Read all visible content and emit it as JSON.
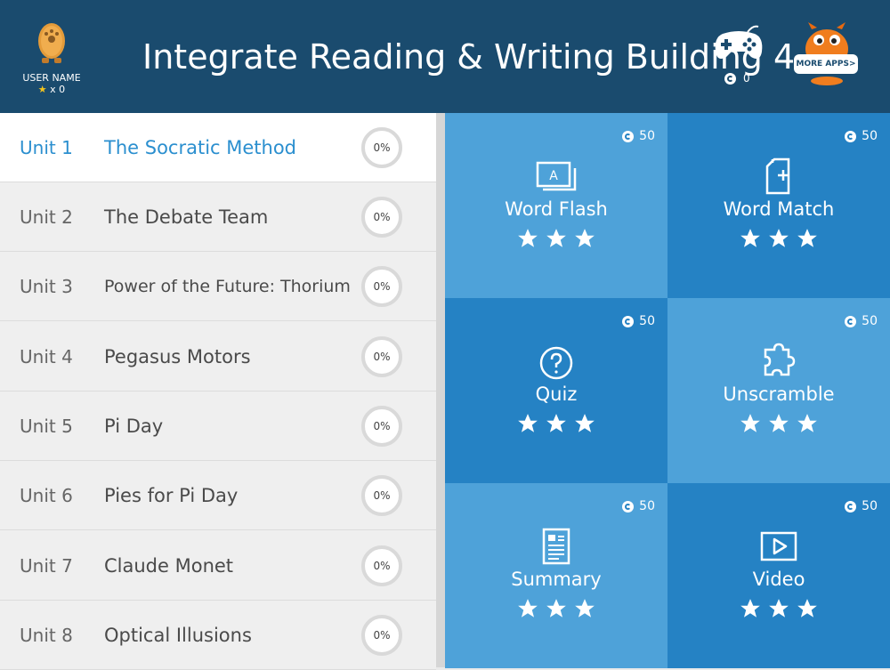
{
  "header": {
    "title": "Integrate Reading & Writing Building 4",
    "user_name": "USER NAME",
    "user_stars": "x 0",
    "coins": "0",
    "more_apps_label": "MORE APPS>"
  },
  "units": [
    {
      "unit": "Unit 1",
      "name": "The Socratic Method",
      "progress": "0%",
      "active": true
    },
    {
      "unit": "Unit 2",
      "name": "The Debate Team",
      "progress": "0%"
    },
    {
      "unit": "Unit 3",
      "name": "Power of the Future: Thorium",
      "progress": "0%"
    },
    {
      "unit": "Unit 4",
      "name": "Pegasus Motors",
      "progress": "0%"
    },
    {
      "unit": "Unit 5",
      "name": "Pi Day",
      "progress": "0%"
    },
    {
      "unit": "Unit 6",
      "name": "Pies for Pi Day",
      "progress": "0%"
    },
    {
      "unit": "Unit 7",
      "name": "Claude Monet",
      "progress": "0%"
    },
    {
      "unit": "Unit 8",
      "name": "Optical Illusions",
      "progress": "0%"
    }
  ],
  "activities": [
    {
      "name": "Word Flash",
      "cost": "50",
      "icon": "word-flash-icon",
      "stars": 3
    },
    {
      "name": "Word Match",
      "cost": "50",
      "icon": "word-match-icon",
      "stars": 3
    },
    {
      "name": "Quiz",
      "cost": "50",
      "icon": "quiz-icon",
      "stars": 3
    },
    {
      "name": "Unscramble",
      "cost": "50",
      "icon": "puzzle-icon",
      "stars": 3
    },
    {
      "name": "Summary",
      "cost": "50",
      "icon": "summary-icon",
      "stars": 3
    },
    {
      "name": "Video",
      "cost": "50",
      "icon": "video-icon",
      "stars": 3
    }
  ],
  "colors": {
    "header": "#1a4b6e",
    "tile_light": "#4ea2d9",
    "tile_dark": "#2582c4",
    "active_text": "#2b8fcf",
    "star_user": "#f4c51d"
  }
}
